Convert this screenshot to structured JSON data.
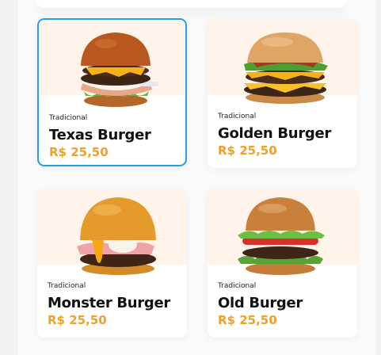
{
  "colors": {
    "accent_price": "#f0a12a",
    "selected_border": "#2d9be8",
    "image_background": "#fff3ea"
  },
  "products": [
    {
      "category": "Tradicional",
      "name": "Texas Burger",
      "price": "R$ 25,50",
      "selected": true,
      "image": "texas-burger-image"
    },
    {
      "category": "Tradicional",
      "name": "Golden Burger",
      "price": "R$ 25,50",
      "selected": false,
      "image": "golden-burger-image"
    },
    {
      "category": "Tradicional",
      "name": "Monster Burger",
      "price": "R$ 25,50",
      "selected": false,
      "image": "monster-burger-image"
    },
    {
      "category": "Tradicional",
      "name": "Old Burger",
      "price": "R$ 25,50",
      "selected": false,
      "image": "old-burger-image"
    }
  ]
}
